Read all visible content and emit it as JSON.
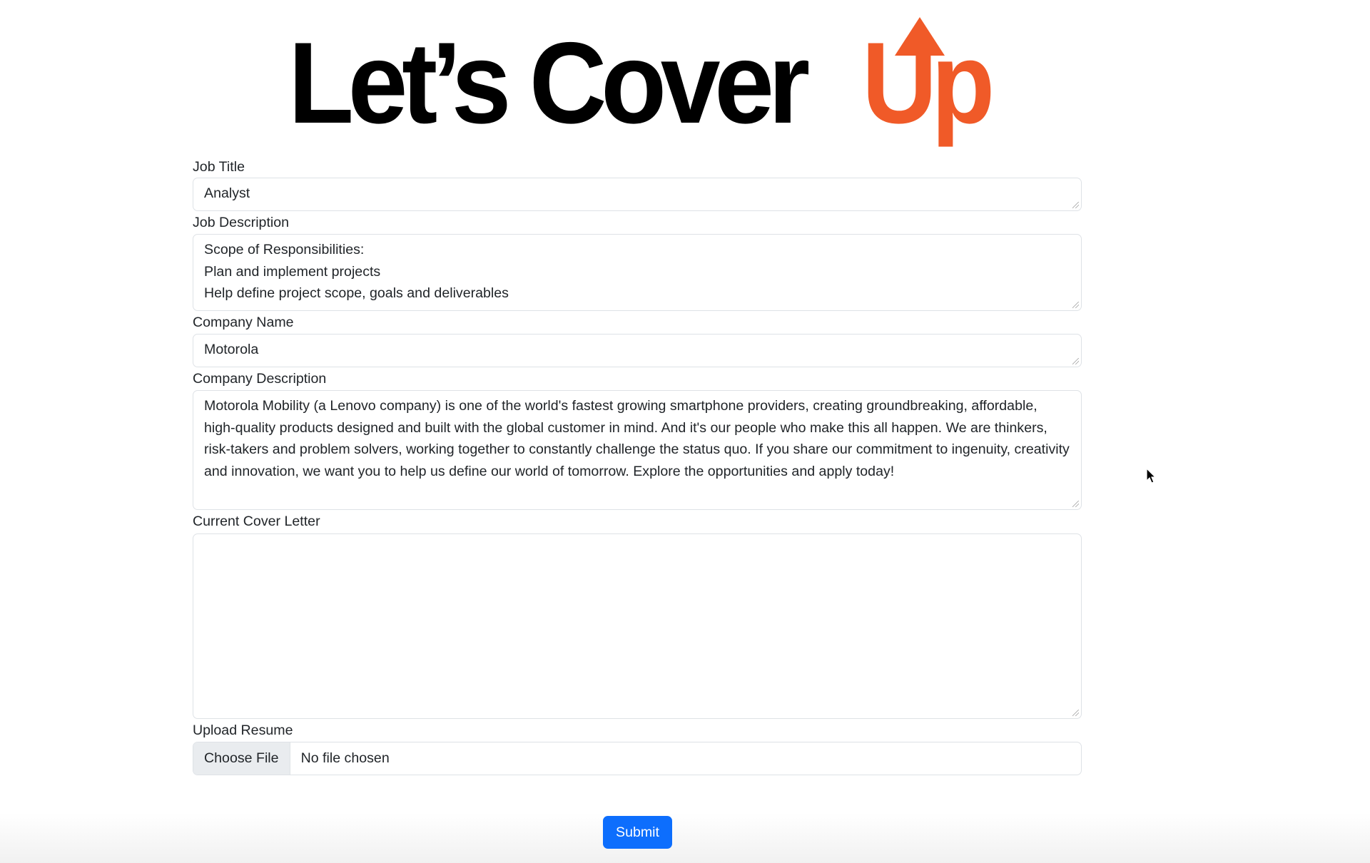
{
  "logo": {
    "text_black": "Let’s Cover",
    "text_orange": "Up",
    "accent_color": "#f05a28"
  },
  "form": {
    "job_title": {
      "label": "Job Title",
      "value": "Analyst"
    },
    "job_description": {
      "label": "Job Description",
      "value": "Scope of Responsibilities:\nPlan and implement projects\nHelp define project scope, goals and deliverables"
    },
    "company_name": {
      "label": "Company Name",
      "value": "Motorola"
    },
    "company_description": {
      "label": "Company Description",
      "value": "Motorola Mobility (a Lenovo company) is one of the world's fastest growing smartphone providers, creating groundbreaking, affordable, high-quality products designed and built with the global customer in mind. And it's our people who make this all happen. We are thinkers, risk-takers and problem solvers, working together to constantly challenge the status quo. If you share our commitment to ingenuity, creativity and innovation, we want you to help us define our world of tomorrow. Explore the opportunities and apply today!"
    },
    "cover_letter": {
      "label": "Current Cover Letter",
      "value": ""
    },
    "resume": {
      "label": "Upload Resume",
      "button": "Choose File",
      "status": "No file chosen"
    },
    "submit_label": "Submit",
    "submit_color": "#0d6efd"
  }
}
